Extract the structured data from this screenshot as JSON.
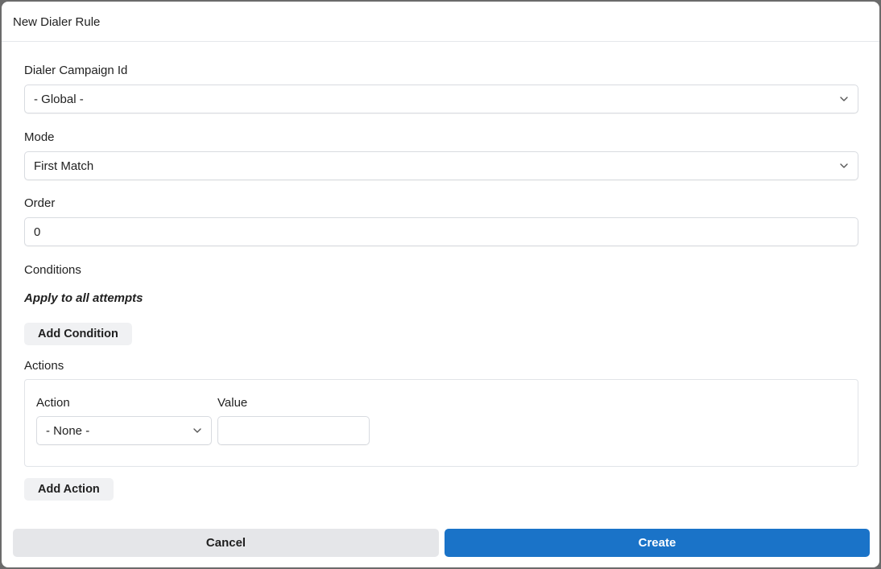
{
  "modal": {
    "title": "New Dialer Rule"
  },
  "fields": {
    "campaign": {
      "label": "Dialer Campaign Id",
      "value": "- Global -"
    },
    "mode": {
      "label": "Mode",
      "value": "First Match"
    },
    "order": {
      "label": "Order",
      "value": "0"
    }
  },
  "conditions": {
    "label": "Conditions",
    "note": "Apply to all attempts",
    "add_label": "Add Condition"
  },
  "actions": {
    "label": "Actions",
    "action_label": "Action",
    "value_label": "Value",
    "action_value": "- None -",
    "value_value": "",
    "add_label": "Add Action"
  },
  "footer": {
    "cancel_label": "Cancel",
    "create_label": "Create"
  },
  "colors": {
    "primary": "#1a73c8",
    "secondary": "#e5e6e9"
  }
}
